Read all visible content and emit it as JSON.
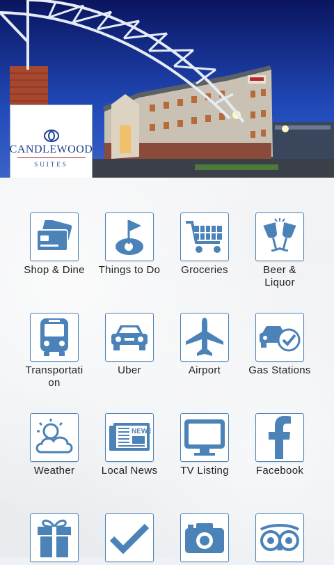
{
  "hero": {
    "brand_name": "CANDLEWOOD",
    "brand_sub": "SUITES",
    "sign_text": "CANDLEWOOD"
  },
  "menu": {
    "row1": [
      {
        "label": "Shop & Dine",
        "icon": "credit-cards-icon"
      },
      {
        "label": "Things to Do",
        "icon": "golf-flag-icon"
      },
      {
        "label": "Groceries",
        "icon": "shopping-cart-icon"
      },
      {
        "label": "Beer & Liquor",
        "icon": "wine-glasses-icon"
      }
    ],
    "row2": [
      {
        "label": "Transportation",
        "icon": "bus-icon"
      },
      {
        "label": "Uber",
        "icon": "car-icon"
      },
      {
        "label": "Airport",
        "icon": "airplane-icon"
      },
      {
        "label": "Gas Stations",
        "icon": "car-check-icon"
      }
    ],
    "row3": [
      {
        "label": "Weather",
        "icon": "weather-icon"
      },
      {
        "label": "Local News",
        "icon": "newspaper-icon"
      },
      {
        "label": "TV Listing",
        "icon": "tv-icon"
      },
      {
        "label": "Facebook",
        "icon": "facebook-icon"
      }
    ],
    "row4": [
      {
        "label": "",
        "icon": "gift-icon"
      },
      {
        "label": "",
        "icon": "checkmark-icon"
      },
      {
        "label": "",
        "icon": "camera-icon"
      },
      {
        "label": "",
        "icon": "tripadvisor-owl-icon"
      }
    ]
  },
  "colors": {
    "icon_blue": "#4b82b8",
    "brand_blue": "#1b3f8f",
    "brand_red": "#b8262b"
  }
}
